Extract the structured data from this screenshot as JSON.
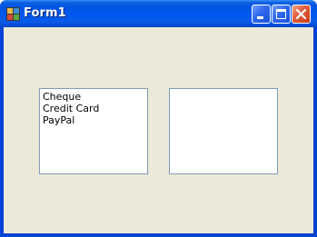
{
  "window": {
    "title": "Form1"
  },
  "controls": {
    "minimize": "minimize-icon",
    "maximize": "maximize-icon",
    "close": "close-icon"
  },
  "listbox_left": {
    "items": [
      "Cheque",
      "Credit Card",
      "PayPal"
    ]
  },
  "listbox_right": {
    "items": []
  },
  "colors": {
    "titlebar": "#0054e3",
    "client_background": "#ece9d8",
    "listbox_border": "#7f9db9",
    "close_button": "#e0603c"
  }
}
